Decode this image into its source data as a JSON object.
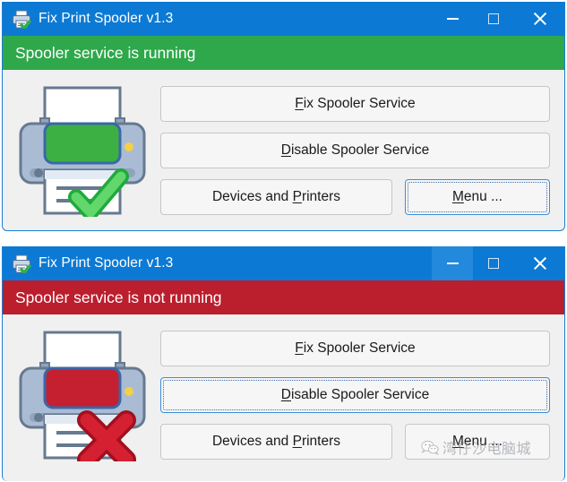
{
  "app": {
    "title": "Fix Print Spooler v1.3",
    "title_icon": "printer-check-icon"
  },
  "window_controls": {
    "minimize": "minimize-icon",
    "maximize": "maximize-icon",
    "close": "close-icon"
  },
  "windows": [
    {
      "id": "running",
      "status_text": "Spooler service is running",
      "status_color": "#2ea84a",
      "printer_state": "ok",
      "printer_panel_color": "#3cb043",
      "printer_mark": "green-check",
      "minimize_hover": false,
      "buttons": {
        "fix": {
          "pre": "F",
          "rest": "ix Spooler Service",
          "focused": false
        },
        "disable": {
          "pre": "D",
          "rest": "isable Spooler Service",
          "focused": false
        },
        "devices": {
          "pre": "Devices and ",
          "accel": "P",
          "rest": "rinters",
          "focused": false
        },
        "menu": {
          "pre": "M",
          "rest": "enu ...",
          "focused": true
        }
      }
    },
    {
      "id": "stopped",
      "status_text": "Spooler service is not running",
      "status_color": "#bb1e2d",
      "printer_state": "fail",
      "printer_panel_color": "#c4202f",
      "printer_mark": "red-cross",
      "minimize_hover": true,
      "buttons": {
        "fix": {
          "pre": "F",
          "rest": "ix Spooler Service",
          "focused": false
        },
        "disable": {
          "pre": "D",
          "rest": "isable Spooler Service",
          "focused": true
        },
        "devices": {
          "pre": "Devices and ",
          "accel": "P",
          "rest": "rinters",
          "focused": false
        },
        "menu": {
          "pre": "M",
          "rest": "enu ...",
          "focused": false
        }
      }
    }
  ],
  "watermark": {
    "logo": "wechat-logo-icon",
    "text": "湾仔沙电脑城"
  },
  "colors": {
    "titlebar": "#0c7ad4",
    "titlebar_hover": "#2289dc",
    "body": "#f0f0f0",
    "button_face": "#f6f6f6",
    "button_border": "#c6c6c6",
    "focus_border": "#3a8fd9",
    "status_ok": "#2ea84a",
    "status_fail": "#bb1e2d",
    "printer_body": "#a9bcd4",
    "printer_outline": "#66798f",
    "led": "#f5cf45"
  }
}
